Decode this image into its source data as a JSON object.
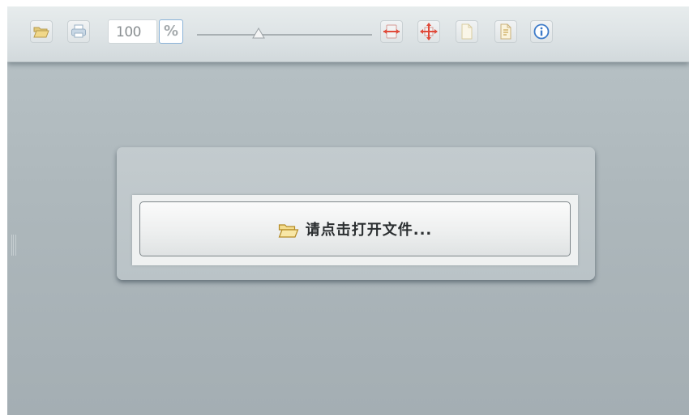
{
  "toolbar": {
    "open_icon": "folder-open-icon",
    "print_icon": "print-icon",
    "zoom_value": "100",
    "zoom_unit": "%",
    "zoom_level_fraction": 0.35,
    "fit_width_icon": "fit-width-icon",
    "fit_page_icon": "fit-page-icon",
    "single_page_icon": "single-page-icon",
    "continuous_page_icon": "continuous-page-icon",
    "about_icon": "info-icon"
  },
  "dialog": {
    "open_button_label": "请点击打开文件...",
    "open_button_icon": "folder-open-icon"
  },
  "colors": {
    "viewer_background": "#aeb8bc",
    "toolbar_background": "#dde3e5",
    "accent_red": "#e04a3a",
    "info_blue": "#3d7bc9",
    "folder_yellow": "#e8c25a"
  }
}
